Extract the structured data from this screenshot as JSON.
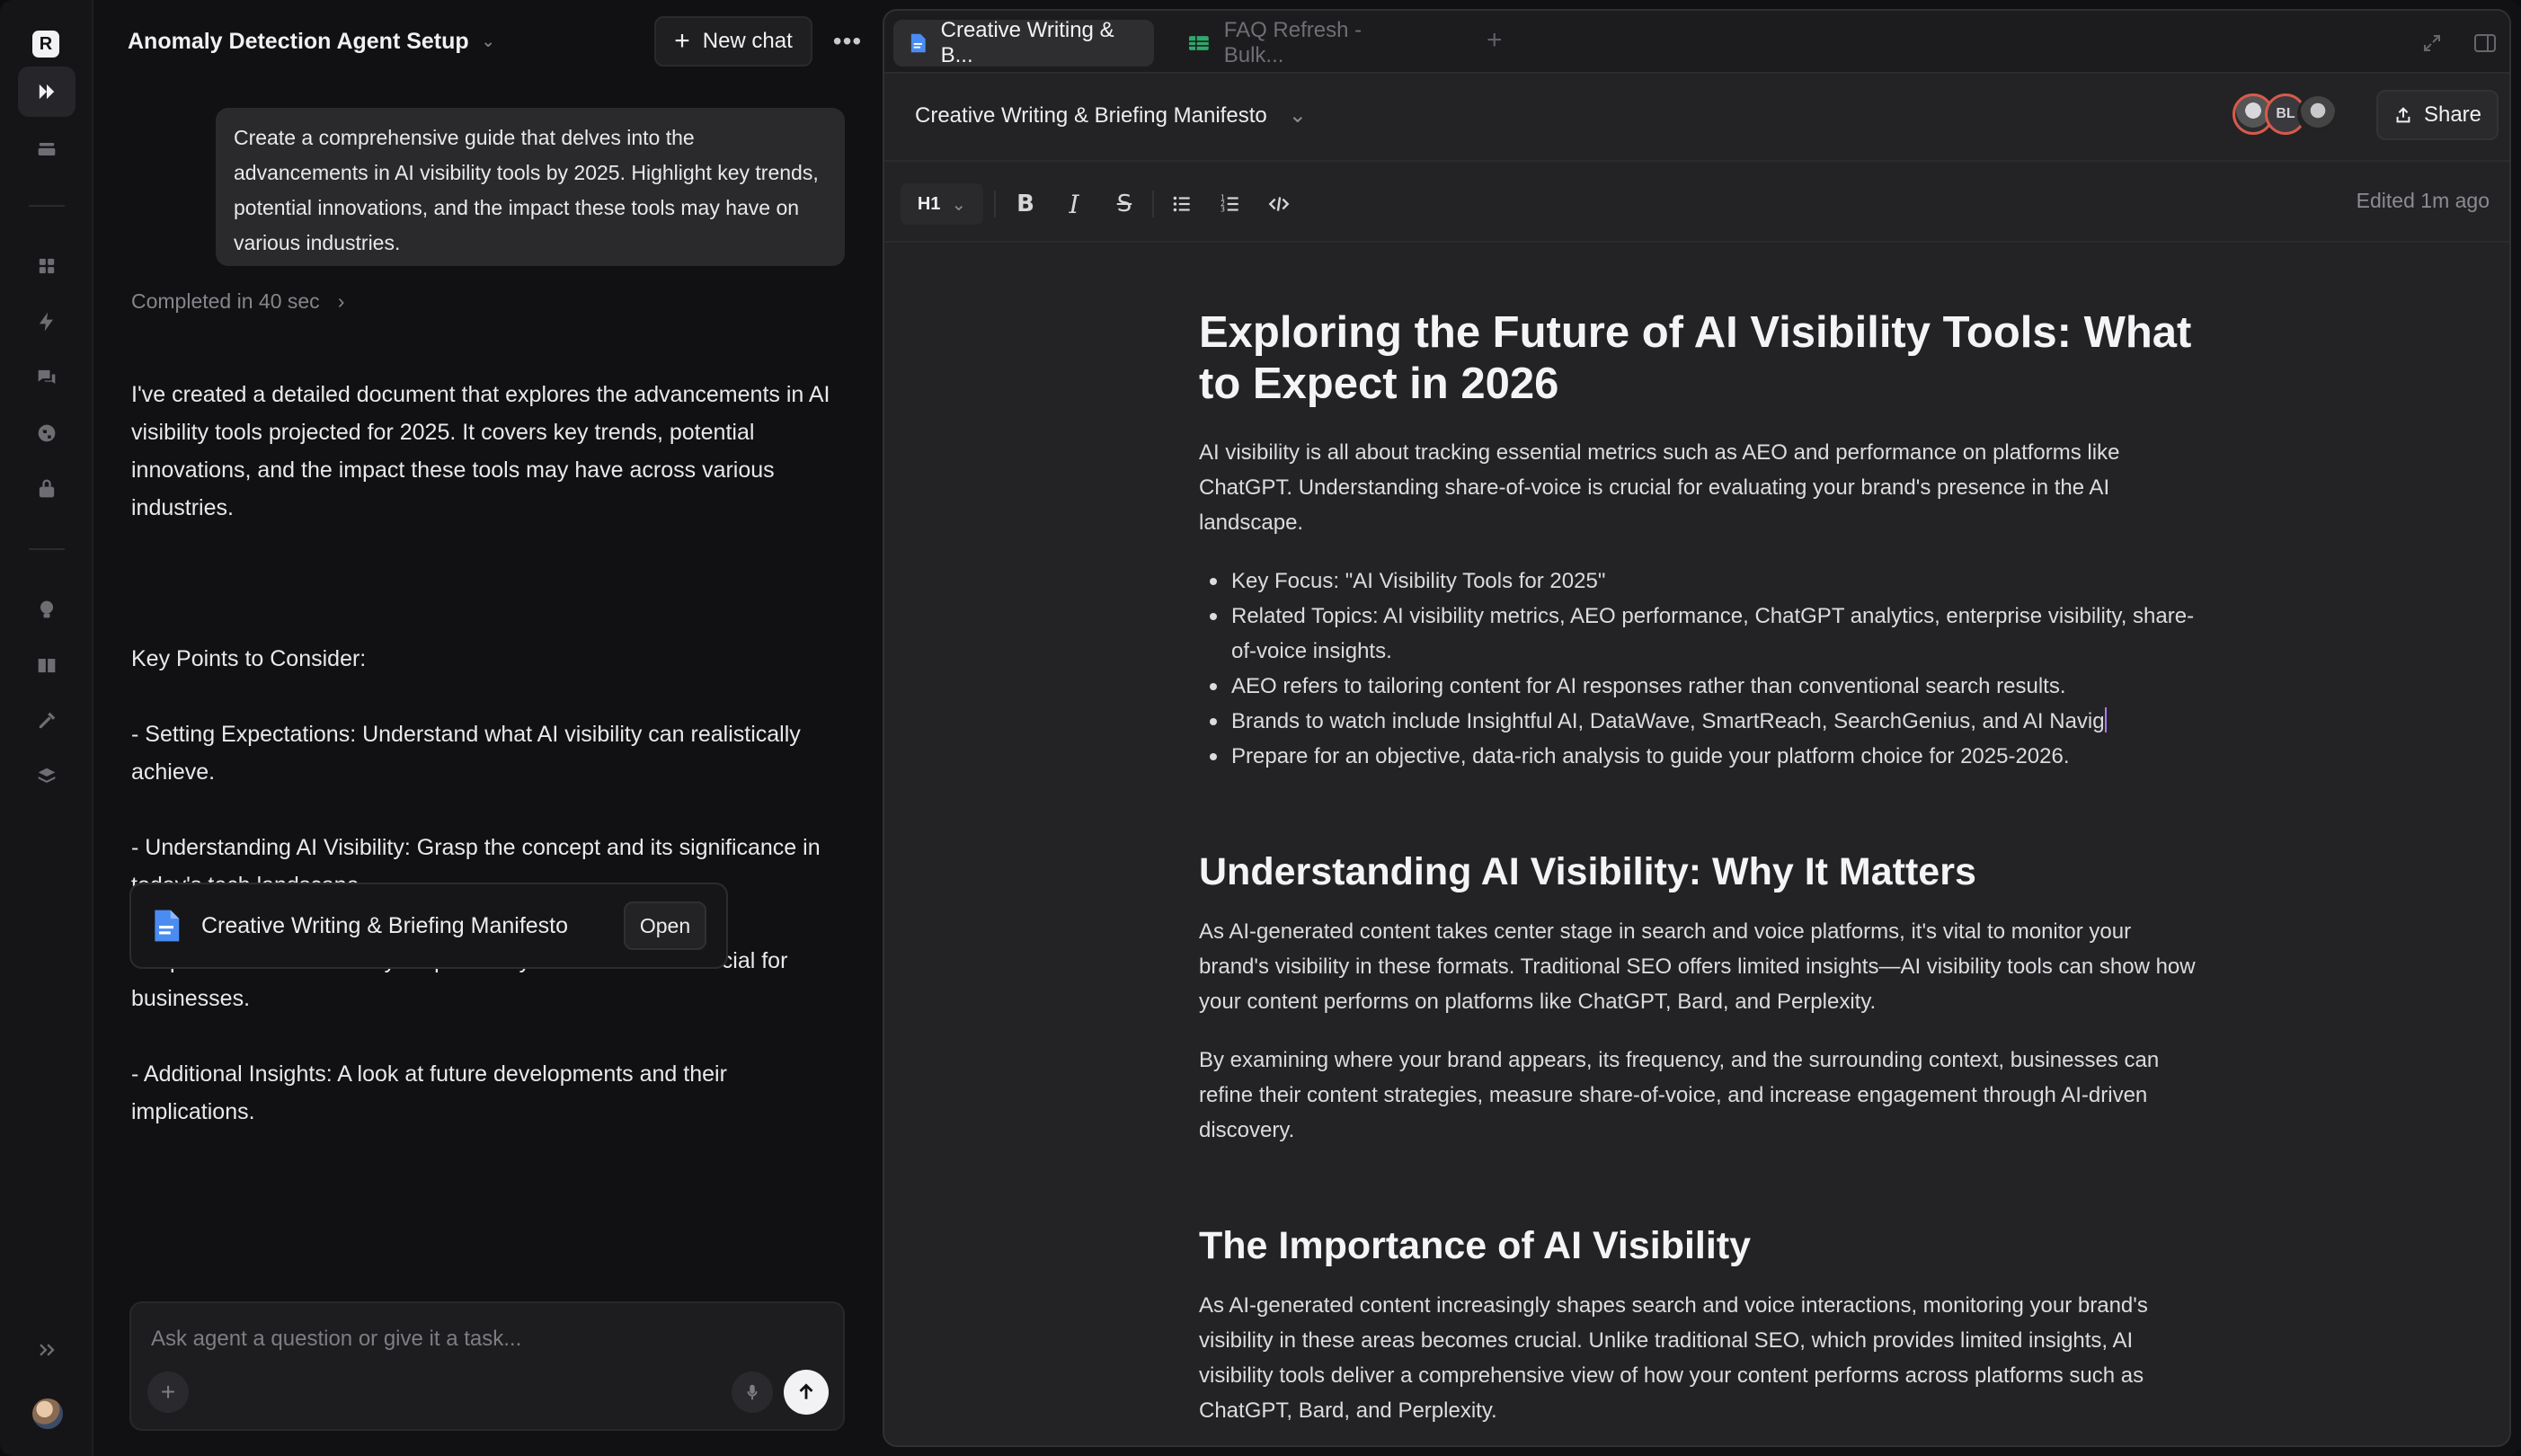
{
  "rail": {
    "logo": "R",
    "items": [
      "forward-icon",
      "inbox-icon",
      "grid-icon",
      "bolt-icon",
      "chat-bubbles-icon",
      "globe-icon",
      "lock-icon",
      "lightbulb-icon",
      "book-icon",
      "tools-icon",
      "layers-icon",
      "expand-icon"
    ]
  },
  "chat": {
    "title": "Anomaly Detection Agent Setup",
    "new_chat": "New chat",
    "user_message": "Create a comprehensive guide that delves into the advancements in AI visibility tools by 2025. Highlight key trends, potential innovations, and the impact these tools may have on various industries.",
    "completed": "Completed in 40 sec",
    "reply_intro": "I've created a detailed document that explores the advancements in AI visibility tools projected for 2025. It covers key trends, potential innovations, and the impact these tools may have across various industries.",
    "key_points_title": "Key Points to Consider:",
    "key_points": [
      "- Setting Expectations: Understand what AI visibility can realistically achieve.",
      "- Understanding AI Visibility: Grasp the concept and its significance in today's tech landscape.",
      "- Importance of AI Visibility: Explore why these tools are crucial for businesses.",
      "- Additional Insights: A look at future developments and their implications."
    ],
    "doc_card_name": "Creative Writing & Briefing Manifesto",
    "doc_card_open": "Open",
    "composer_placeholder": "Ask agent a question or give it a task..."
  },
  "doc": {
    "tabs": [
      {
        "label": "Creative Writing & B...",
        "icon": "doc-icon",
        "active": true
      },
      {
        "label": "FAQ Refresh - Bulk...",
        "icon": "sheet-icon",
        "active": false
      }
    ],
    "title": "Creative Writing & Briefing Manifesto",
    "avatar_initials": "BL",
    "share": "Share",
    "heading_select": "H1",
    "edited": "Edited 1m ago",
    "h1": "Exploring the Future of AI Visibility Tools: What to Expect in 2026",
    "intro": "AI visibility is all about tracking essential metrics such as AEO and performance on platforms like ChatGPT. Understanding share-of-voice is crucial for evaluating your brand's presence in the AI landscape.",
    "bullets": [
      "Key Focus: \"AI Visibility Tools for 2025\"",
      "Related Topics: AI visibility metrics, AEO performance, ChatGPT analytics, enterprise visibility, share-of-voice insights.",
      "AEO refers to tailoring content for AI responses rather than conventional search results.",
      "Brands to watch include Insightful AI, DataWave, SmartReach, SearchGenius, and AI Navig",
      "Prepare for an objective, data-rich analysis to guide your platform choice for 2025-2026."
    ],
    "h2_1": "Understanding AI Visibility: Why It Matters",
    "p1": "As AI-generated content takes center stage in search and voice platforms, it's vital to monitor your brand's visibility in these formats. Traditional SEO offers limited insights—AI visibility tools can show how your content performs on platforms like ChatGPT, Bard, and Perplexity.",
    "p2": "By examining where your brand appears, its frequency, and the surrounding context, businesses can refine their content strategies, measure share-of-voice, and increase engagement through AI-driven discovery.",
    "h2_2": "The Importance of AI Visibility",
    "p3": "As AI-generated content increasingly shapes search and voice interactions, monitoring your brand's visibility in these areas becomes crucial. Unlike traditional SEO, which provides limited insights, AI visibility tools deliver a comprehensive view of how your content performs across platforms such as ChatGPT, Bard, and Perplexity."
  },
  "colors": {
    "accent_doc": "#4a8cf2",
    "accent_sheet": "#2fa86a",
    "caret": "#a97cf5",
    "avatar_ring": "#d85a4a"
  }
}
